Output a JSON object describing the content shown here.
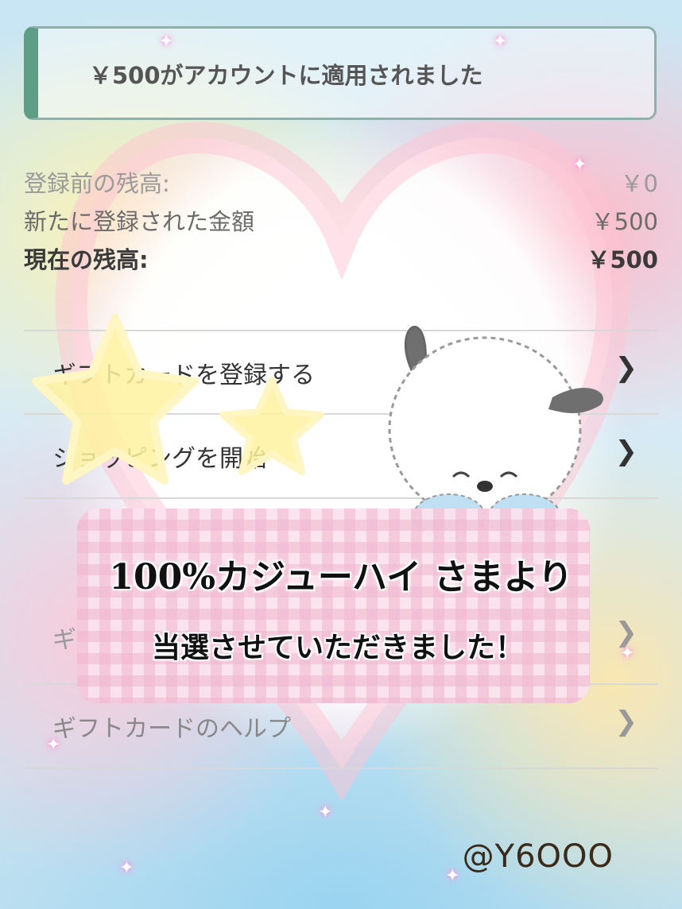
{
  "banner": {
    "text": "￥500がアカウントに適用されました"
  },
  "balance": {
    "before_label": "登録前の残高:",
    "before_value": "￥0",
    "added_label": "新たに登録された金額",
    "added_value": "￥500",
    "current_label": "現在の残高:",
    "current_value": "￥500"
  },
  "menu": {
    "items": [
      {
        "label": "ギフトカードを登録する",
        "icon": "chevron-right-icon"
      },
      {
        "label": "ショッピングを開始",
        "icon": "chevron-right-icon"
      },
      {
        "label": "ギ",
        "icon": "chevron-right-icon"
      },
      {
        "label": "ギフトカードのヘルプ",
        "icon": "chevron-right-icon"
      }
    ]
  },
  "overlay": {
    "line1": "100%カジューハイ さまより",
    "line2": "当選させていただきました！"
  },
  "handle": "@Y6OOO",
  "colors": {
    "banner_accent": "#5e9d86",
    "heart_pink": "#ffb3c8",
    "star_yellow": "#fff3a6"
  }
}
